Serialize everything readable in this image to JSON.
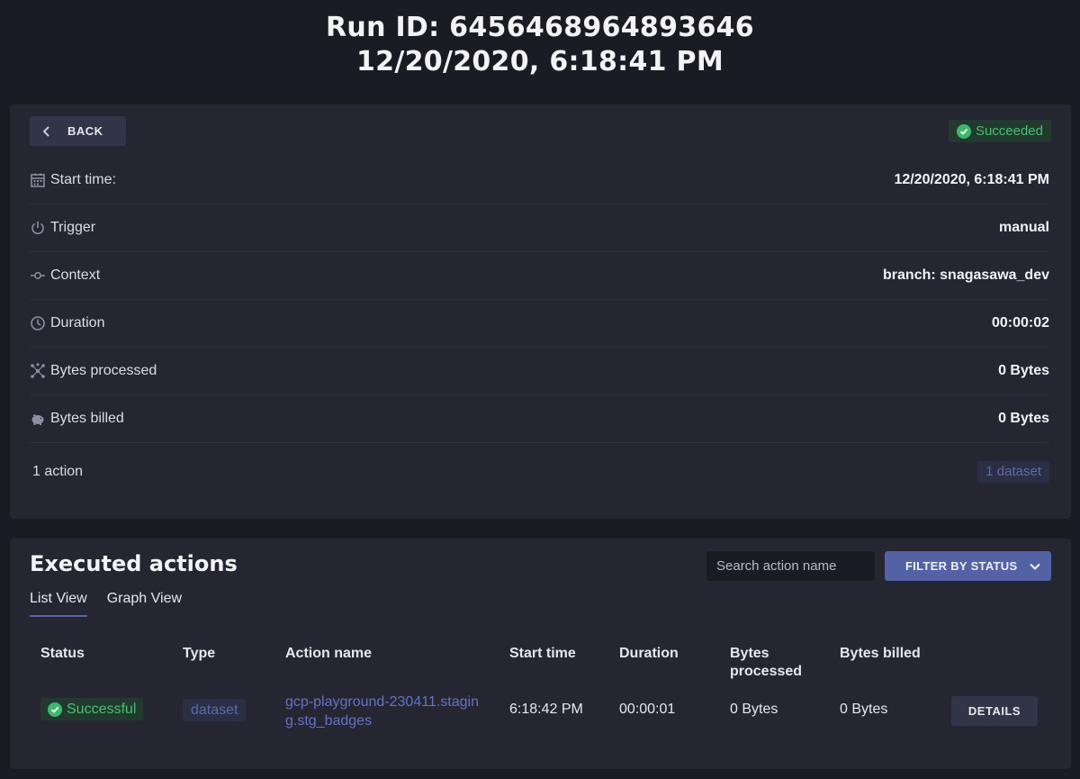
{
  "header": {
    "run_id_line": "Run ID: 6456468964893646",
    "datetime_line": "12/20/2020, 6:18:41 PM"
  },
  "summary": {
    "back_label": "BACK",
    "status": "Succeeded",
    "rows": [
      {
        "icon": "calendar-icon",
        "label": "Start time:",
        "value": "12/20/2020, 6:18:41 PM"
      },
      {
        "icon": "power-icon",
        "label": "Trigger",
        "value": "manual"
      },
      {
        "icon": "commit-icon",
        "label": "Context",
        "value": "branch: snagasawa_dev"
      },
      {
        "icon": "clock-icon",
        "label": "Duration",
        "value": "00:00:02"
      },
      {
        "icon": "network-icon",
        "label": "Bytes processed",
        "value": "0 Bytes"
      },
      {
        "icon": "piggy-bank-icon",
        "label": "Bytes billed",
        "value": "0 Bytes"
      }
    ],
    "actions_count": "1 action",
    "dataset_badge": "1 dataset"
  },
  "executed": {
    "title": "Executed actions",
    "search_placeholder": "Search action name",
    "filter_label": "FILTER BY STATUS",
    "tabs": [
      "List View",
      "Graph View"
    ],
    "active_tab": "List View",
    "columns": [
      "Status",
      "Type",
      "Action name",
      "Start time",
      "Duration",
      "Bytes processed",
      "Bytes billed"
    ],
    "rows": [
      {
        "status": "Successful",
        "type": "dataset",
        "action_name": "gcp-playground-230411.staging.stg_badges",
        "start_time": "6:18:42 PM",
        "duration": "00:00:01",
        "bytes_processed": "0 Bytes",
        "bytes_billed": "0 Bytes",
        "details_label": "DETAILS"
      }
    ]
  },
  "colors": {
    "background": "#1b1c23",
    "card": "#252632",
    "accent": "#5361a5",
    "success": "#3fb86f",
    "link": "#6373c4"
  }
}
